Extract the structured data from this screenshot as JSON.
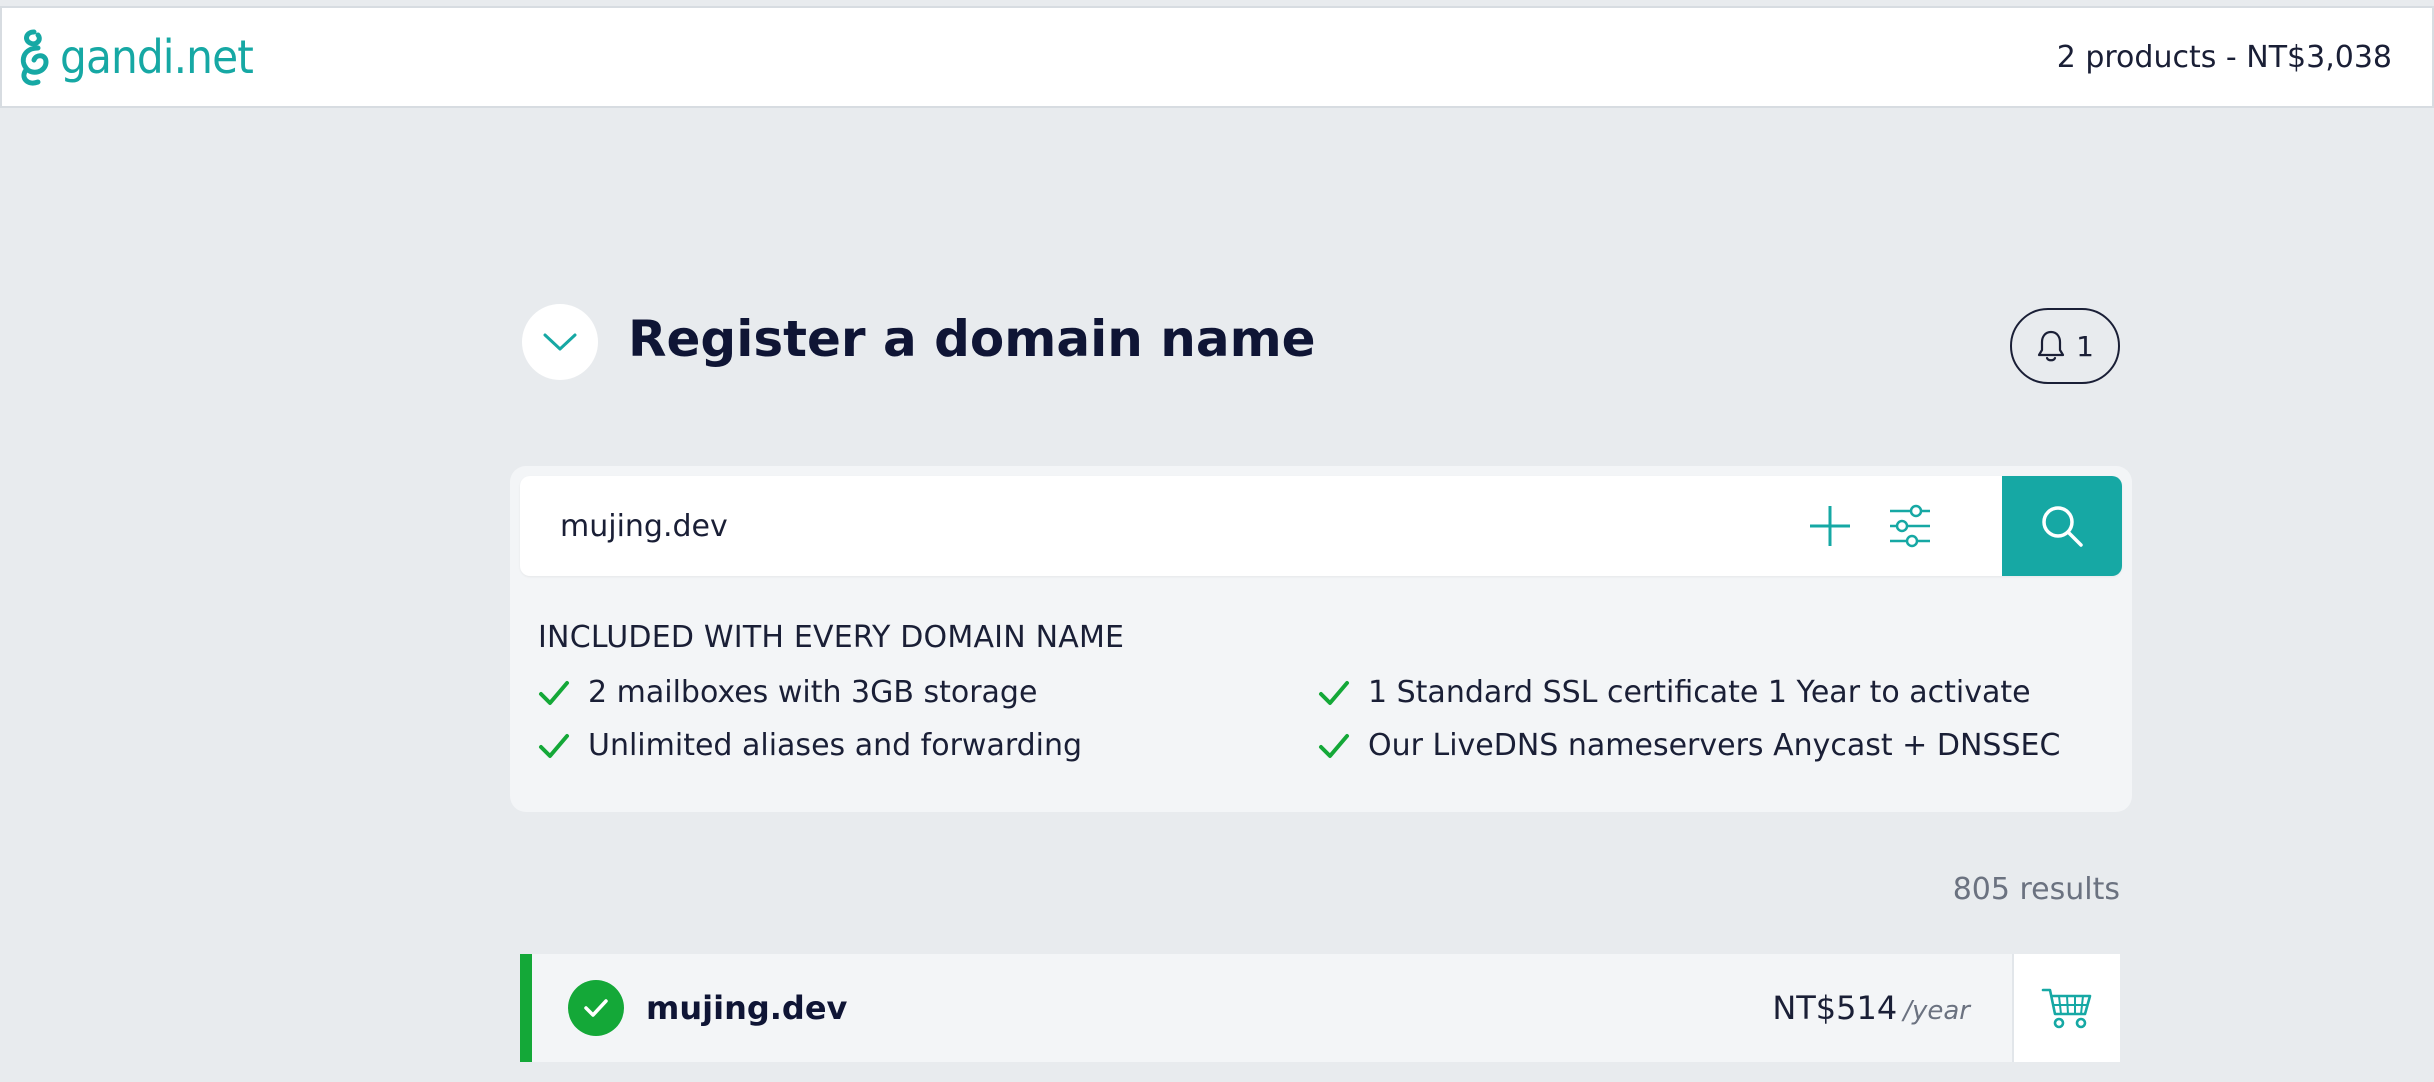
{
  "header": {
    "logo_text": "gandi.net",
    "cart_summary": "2 products - NT$3,038"
  },
  "page": {
    "title": "Register a domain name",
    "notification_count": "1"
  },
  "search": {
    "value": "mujing.dev",
    "placeholder": ""
  },
  "included": {
    "title": "INCLUDED WITH EVERY DOMAIN NAME",
    "features": [
      "2 mailboxes with 3GB storage",
      "1 Standard SSL certificate 1 Year to activate",
      "Unlimited aliases and forwarding",
      "Our LiveDNS nameservers Anycast + DNSSEC"
    ]
  },
  "results": {
    "count_label": "805 results",
    "items": [
      {
        "domain": "mujing.dev",
        "price": "NT$514",
        "unit": "/year",
        "status": "available"
      }
    ]
  },
  "colors": {
    "accent": "#16a8a4",
    "success": "#14a838",
    "background": "#e8ebee",
    "text": "#1a1f36"
  },
  "icons": {
    "logo": "gandi-swirl-icon",
    "collapse": "chevron-down-icon",
    "notification": "bell-icon",
    "add": "plus-icon",
    "filters": "sliders-icon",
    "search": "search-icon",
    "check": "check-icon",
    "cart": "cart-icon"
  }
}
